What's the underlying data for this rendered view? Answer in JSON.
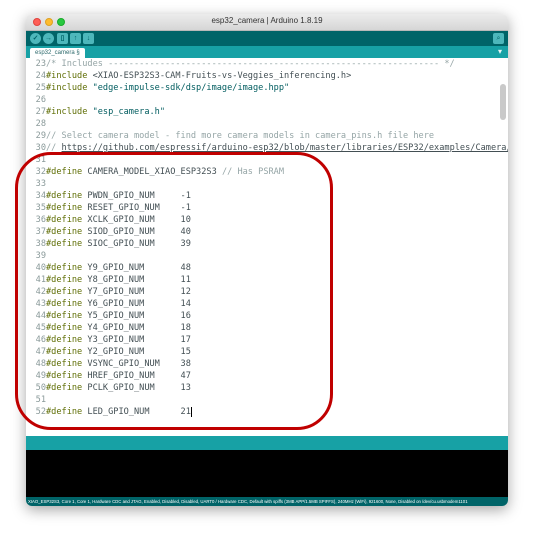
{
  "window": {
    "title": "esp32_camera | Arduino 1.8.19"
  },
  "toolbar": {
    "buttons": [
      "verify-button",
      "upload-button",
      "new-button",
      "open-button",
      "save-button"
    ],
    "verify_glyph": "✓",
    "upload_glyph": "→",
    "new_glyph": "▯",
    "open_glyph": "↑",
    "save_glyph": "↓",
    "serial_glyph": "⌕"
  },
  "tab": {
    "label": "esp32_camera §",
    "menu_glyph": "▾"
  },
  "code": [
    {
      "n": "23",
      "parts": [
        [
          "cm",
          "/* Includes ---------------------------------------------------------------- */"
        ]
      ]
    },
    {
      "n": "24",
      "parts": [
        [
          "kw",
          "#include "
        ],
        [
          "pl",
          "<XIAO-ESP32S3-CAM-Fruits-vs-Veggies_inferencing.h>"
        ]
      ]
    },
    {
      "n": "25",
      "parts": [
        [
          "kw",
          "#include "
        ],
        [
          "str",
          "\"edge-impulse-sdk/dsp/image/image.hpp\""
        ]
      ]
    },
    {
      "n": "26",
      "parts": []
    },
    {
      "n": "27",
      "parts": [
        [
          "kw",
          "#include "
        ],
        [
          "str",
          "\"esp_camera.h\""
        ]
      ]
    },
    {
      "n": "28",
      "parts": []
    },
    {
      "n": "29",
      "parts": [
        [
          "cm",
          "// Select camera model - find more camera models in camera_pins.h file here"
        ]
      ]
    },
    {
      "n": "30",
      "parts": [
        [
          "cm",
          "// "
        ],
        [
          "lnk",
          "https://github.com/espressif/arduino-esp32/blob/master/libraries/ESP32/examples/Camera/"
        ]
      ]
    },
    {
      "n": "31",
      "parts": []
    },
    {
      "n": "32",
      "parts": [
        [
          "kw",
          "#define "
        ],
        [
          "pl",
          "CAMERA_MODEL_XIAO_ESP32S3 "
        ],
        [
          "cm",
          "// Has PSRAM"
        ]
      ]
    },
    {
      "n": "33",
      "parts": []
    },
    {
      "n": "34",
      "parts": [
        [
          "kw",
          "#define "
        ],
        [
          "pl",
          "PWDN_GPIO_NUM     -1"
        ]
      ]
    },
    {
      "n": "35",
      "parts": [
        [
          "kw",
          "#define "
        ],
        [
          "pl",
          "RESET_GPIO_NUM    -1"
        ]
      ]
    },
    {
      "n": "36",
      "parts": [
        [
          "kw",
          "#define "
        ],
        [
          "pl",
          "XCLK_GPIO_NUM     10"
        ]
      ]
    },
    {
      "n": "37",
      "parts": [
        [
          "kw",
          "#define "
        ],
        [
          "pl",
          "SIOD_GPIO_NUM     40"
        ]
      ]
    },
    {
      "n": "38",
      "parts": [
        [
          "kw",
          "#define "
        ],
        [
          "pl",
          "SIOC_GPIO_NUM     39"
        ]
      ]
    },
    {
      "n": "39",
      "parts": []
    },
    {
      "n": "40",
      "parts": [
        [
          "kw",
          "#define "
        ],
        [
          "pl",
          "Y9_GPIO_NUM       48"
        ]
      ]
    },
    {
      "n": "41",
      "parts": [
        [
          "kw",
          "#define "
        ],
        [
          "pl",
          "Y8_GPIO_NUM       11"
        ]
      ]
    },
    {
      "n": "42",
      "parts": [
        [
          "kw",
          "#define "
        ],
        [
          "pl",
          "Y7_GPIO_NUM       12"
        ]
      ]
    },
    {
      "n": "43",
      "parts": [
        [
          "kw",
          "#define "
        ],
        [
          "pl",
          "Y6_GPIO_NUM       14"
        ]
      ]
    },
    {
      "n": "44",
      "parts": [
        [
          "kw",
          "#define "
        ],
        [
          "pl",
          "Y5_GPIO_NUM       16"
        ]
      ]
    },
    {
      "n": "45",
      "parts": [
        [
          "kw",
          "#define "
        ],
        [
          "pl",
          "Y4_GPIO_NUM       18"
        ]
      ]
    },
    {
      "n": "46",
      "parts": [
        [
          "kw",
          "#define "
        ],
        [
          "pl",
          "Y3_GPIO_NUM       17"
        ]
      ]
    },
    {
      "n": "47",
      "parts": [
        [
          "kw",
          "#define "
        ],
        [
          "pl",
          "Y2_GPIO_NUM       15"
        ]
      ]
    },
    {
      "n": "48",
      "parts": [
        [
          "kw",
          "#define "
        ],
        [
          "pl",
          "VSYNC_GPIO_NUM    38"
        ]
      ]
    },
    {
      "n": "49",
      "parts": [
        [
          "kw",
          "#define "
        ],
        [
          "pl",
          "HREF_GPIO_NUM     47"
        ]
      ]
    },
    {
      "n": "50",
      "parts": [
        [
          "kw",
          "#define "
        ],
        [
          "pl",
          "PCLK_GPIO_NUM     13"
        ]
      ]
    },
    {
      "n": "51",
      "parts": []
    },
    {
      "n": "52",
      "parts": [
        [
          "kw",
          "#define "
        ],
        [
          "pl",
          "LED_GPIO_NUM      21"
        ]
      ]
    }
  ],
  "footer": {
    "board_info": "XIAO_ESP32S3, Core 1, Core 1, Hardware CDC and JTAG, Enabled, Disabled, Disabled, UART0 / Hardware CDC, Default with spiffs (3MB APP/1.5MB SPIFFS), 240MHz (WiFi), 921600, None, Disabled on /dev/cu.usbmodem1101"
  },
  "colors": {
    "toolbar": "#006468",
    "tabbar": "#17a1a5",
    "annotation": "#c00000"
  }
}
